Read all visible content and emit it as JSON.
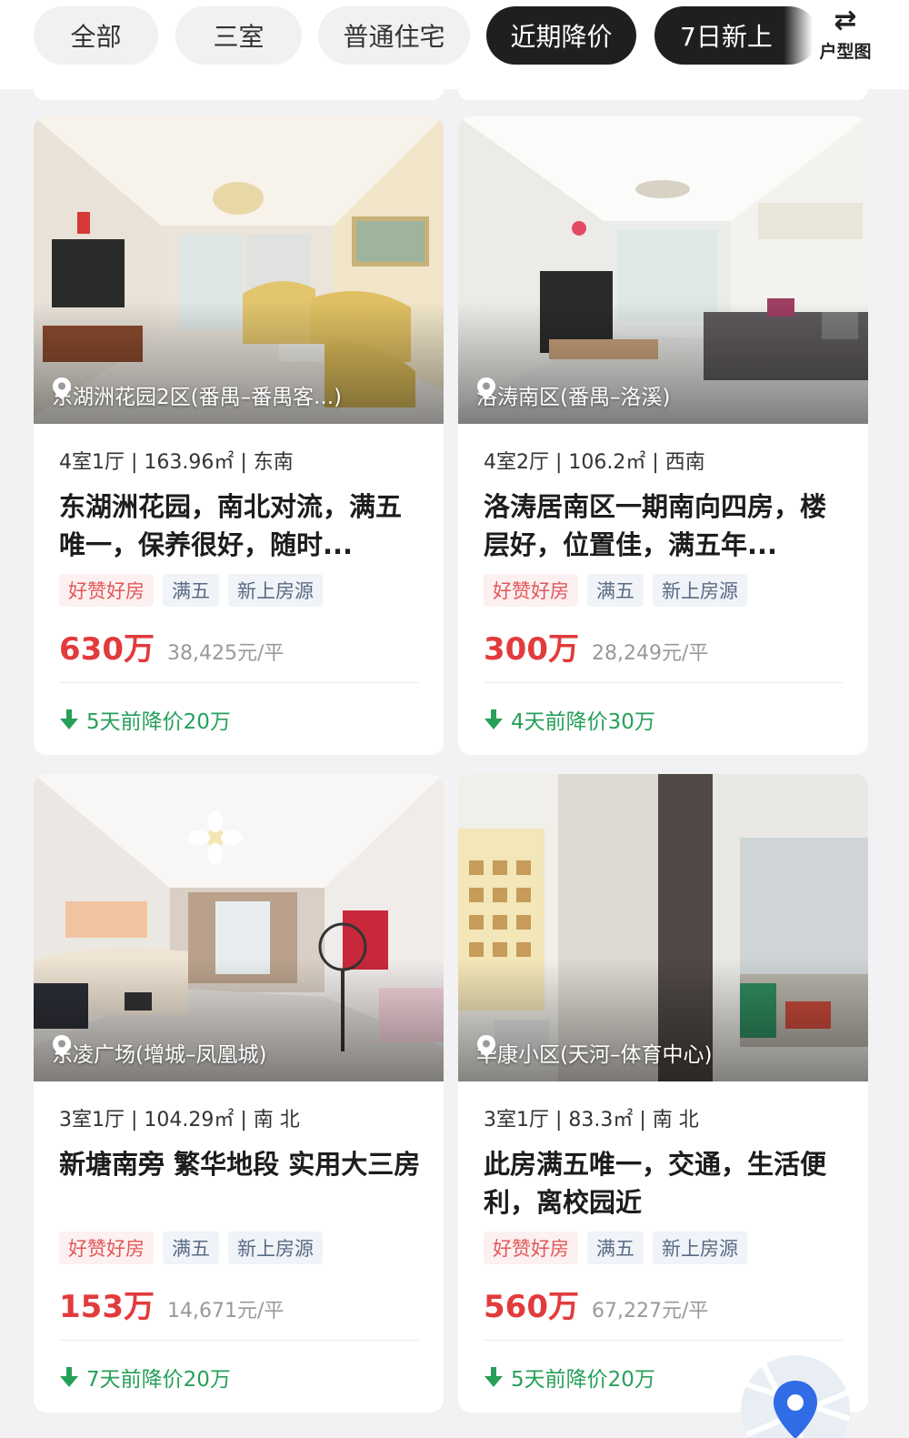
{
  "filters": {
    "chips": [
      {
        "label": "全部",
        "active": false
      },
      {
        "label": "三室",
        "active": false
      },
      {
        "label": "普通住宅",
        "active": false
      },
      {
        "label": "近期降价",
        "active": true
      },
      {
        "label": "7日新上",
        "active": true
      }
    ],
    "layout_toggle": {
      "icon": "swap-arrows-icon",
      "label": "户型图"
    }
  },
  "listings": [
    {
      "location": "东湖洲花园2区(番禺–番禺客...)",
      "specs": "4室1厅 | 163.96㎡ | 东南",
      "title": "东湖洲花园，南北对流，满五唯一，保养很好，随时...",
      "tags": [
        "好赞好房",
        "满五",
        "新上房源"
      ],
      "price": "630万",
      "unit_price": "38,425元/平",
      "price_drop": "5天前降价20万"
    },
    {
      "location": "洛涛南区(番禺–洛溪)",
      "specs": "4室2厅 | 106.2㎡ | 西南",
      "title": "洛涛居南区一期南向四房，楼层好，位置佳，满五年...",
      "tags": [
        "好赞好房",
        "满五",
        "新上房源"
      ],
      "price": "300万",
      "unit_price": "28,249元/平",
      "price_drop": "4天前降价30万"
    },
    {
      "location": "东凌广场(增城–凤凰城)",
      "specs": "3室1厅 | 104.29㎡ | 南 北",
      "title": "新塘南旁 繁华地段 实用大三房",
      "tags": [
        "好赞好房",
        "满五",
        "新上房源"
      ],
      "price": "153万",
      "unit_price": "14,671元/平",
      "price_drop": "7天前降价20万"
    },
    {
      "location": "华康小区(天河–体育中心)",
      "specs": "3室1厅 | 83.3㎡ | 南 北",
      "title": "此房满五唯一，交通，生活便利，离校园近",
      "tags": [
        "好赞好房",
        "满五",
        "新上房源"
      ],
      "price": "560万",
      "unit_price": "67,227元/平",
      "price_drop": "5天前降价20万"
    }
  ],
  "colors": {
    "price": "#e23b3d",
    "drop_green": "#27a05a",
    "active_chip": "#1f1f1f"
  },
  "map_button": {
    "icon": "map-pin-icon"
  }
}
